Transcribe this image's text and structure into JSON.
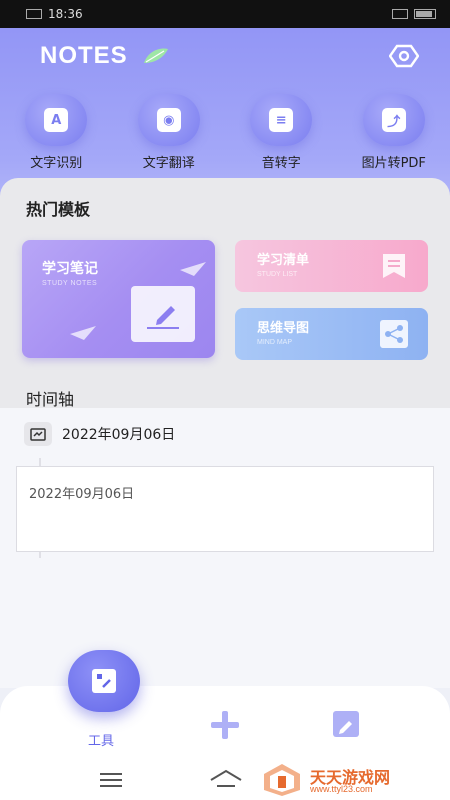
{
  "status_bar": {
    "time": "18:36"
  },
  "header": {
    "title": "NOTES"
  },
  "tools": [
    {
      "label": "文字识别",
      "icon": "text-recognition-icon",
      "glyph": "A"
    },
    {
      "label": "文字翻译",
      "icon": "translate-camera-icon",
      "glyph": "◉"
    },
    {
      "label": "音转字",
      "icon": "audio-to-text-icon",
      "glyph": "≡"
    },
    {
      "label": "图片转PDF",
      "icon": "image-to-pdf-icon",
      "glyph": "⤴"
    }
  ],
  "templates": {
    "title": "热门模板",
    "study_notes": {
      "title": "学习笔记",
      "subtitle": "STUDY NOTES"
    },
    "study_list": {
      "title": "学习清单",
      "subtitle": "STUDY LIST"
    },
    "mind_map": {
      "title": "思维导图",
      "subtitle": "MIND MAP"
    }
  },
  "timeline": {
    "title": "时间轴",
    "date": "2022年09月06日",
    "entry_date": "2022年09月06日"
  },
  "bottom_nav": {
    "tools_label": "工具"
  },
  "watermark": {
    "line1": "天天游戏网",
    "line2": "www.ttyl23.com"
  },
  "colors": {
    "accent": "#6467e8",
    "primary_gradient_top": "#8f92f5"
  }
}
